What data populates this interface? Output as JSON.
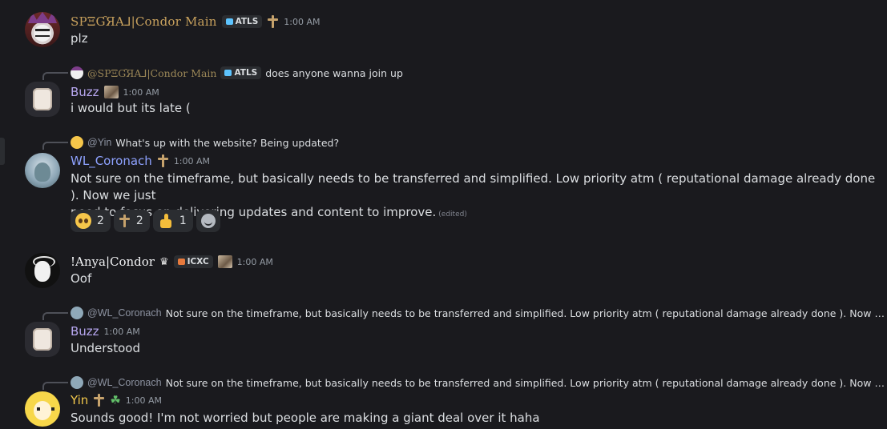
{
  "messages": [
    {
      "author": "SPΞƓЯA⅃|Condor Main",
      "tag": "ATLS",
      "time": "1:00 AM",
      "text": "plz"
    },
    {
      "reply_to": {
        "author": "@SPΞƓЯA⅃|Condor Main",
        "tag": "ATLS",
        "text": "does anyone wanna join up"
      },
      "author": "Buzz",
      "time": "1:00 AM",
      "text": "i would but its late ("
    },
    {
      "reply_to": {
        "author": "@Yin",
        "text": "What's up with the website? Being updated?"
      },
      "author": "WL_Coronach",
      "time": "1:00 AM",
      "text_line1": "Not sure on the timeframe, but basically needs to be transferred and simplified. Low priority atm ( reputational damage already done ). Now we just",
      "text_line2": "need to focus on delivering updates and content to improve.",
      "edited": "(edited)",
      "reactions": [
        {
          "emoji": "pleading-face",
          "count": "2"
        },
        {
          "emoji": "sword-emblem",
          "count": "2"
        },
        {
          "emoji": "thumbs-up",
          "count": "1"
        }
      ]
    },
    {
      "author": "!Anya|Condor",
      "tag": "ICXC",
      "time": "1:00 AM",
      "text": "Oof"
    },
    {
      "reply_to": {
        "author": "@WL_Coronach",
        "text": "Not sure on the timeframe, but basically needs to be transferred and simplified. Low priority atm ( reputational damage already done ). Now we just ..."
      },
      "author": "Buzz",
      "time": "1:00 AM",
      "text": "Understood"
    },
    {
      "reply_to": {
        "author": "@WL_Coronach",
        "text": "Not sure on the timeframe, but basically needs to be transferred and simplified. Low priority atm ( reputational damage already done ). Now we just ..."
      },
      "author": "Yin",
      "time": "1:00 AM",
      "text": "Sounds good! I'm not worried but people are making a giant deal over it haha"
    }
  ],
  "colors": {
    "background": "#1a1a1e",
    "text": "#dbdee1",
    "timestamp": "#949ba4",
    "reaction_bg": "#2b2d31"
  }
}
